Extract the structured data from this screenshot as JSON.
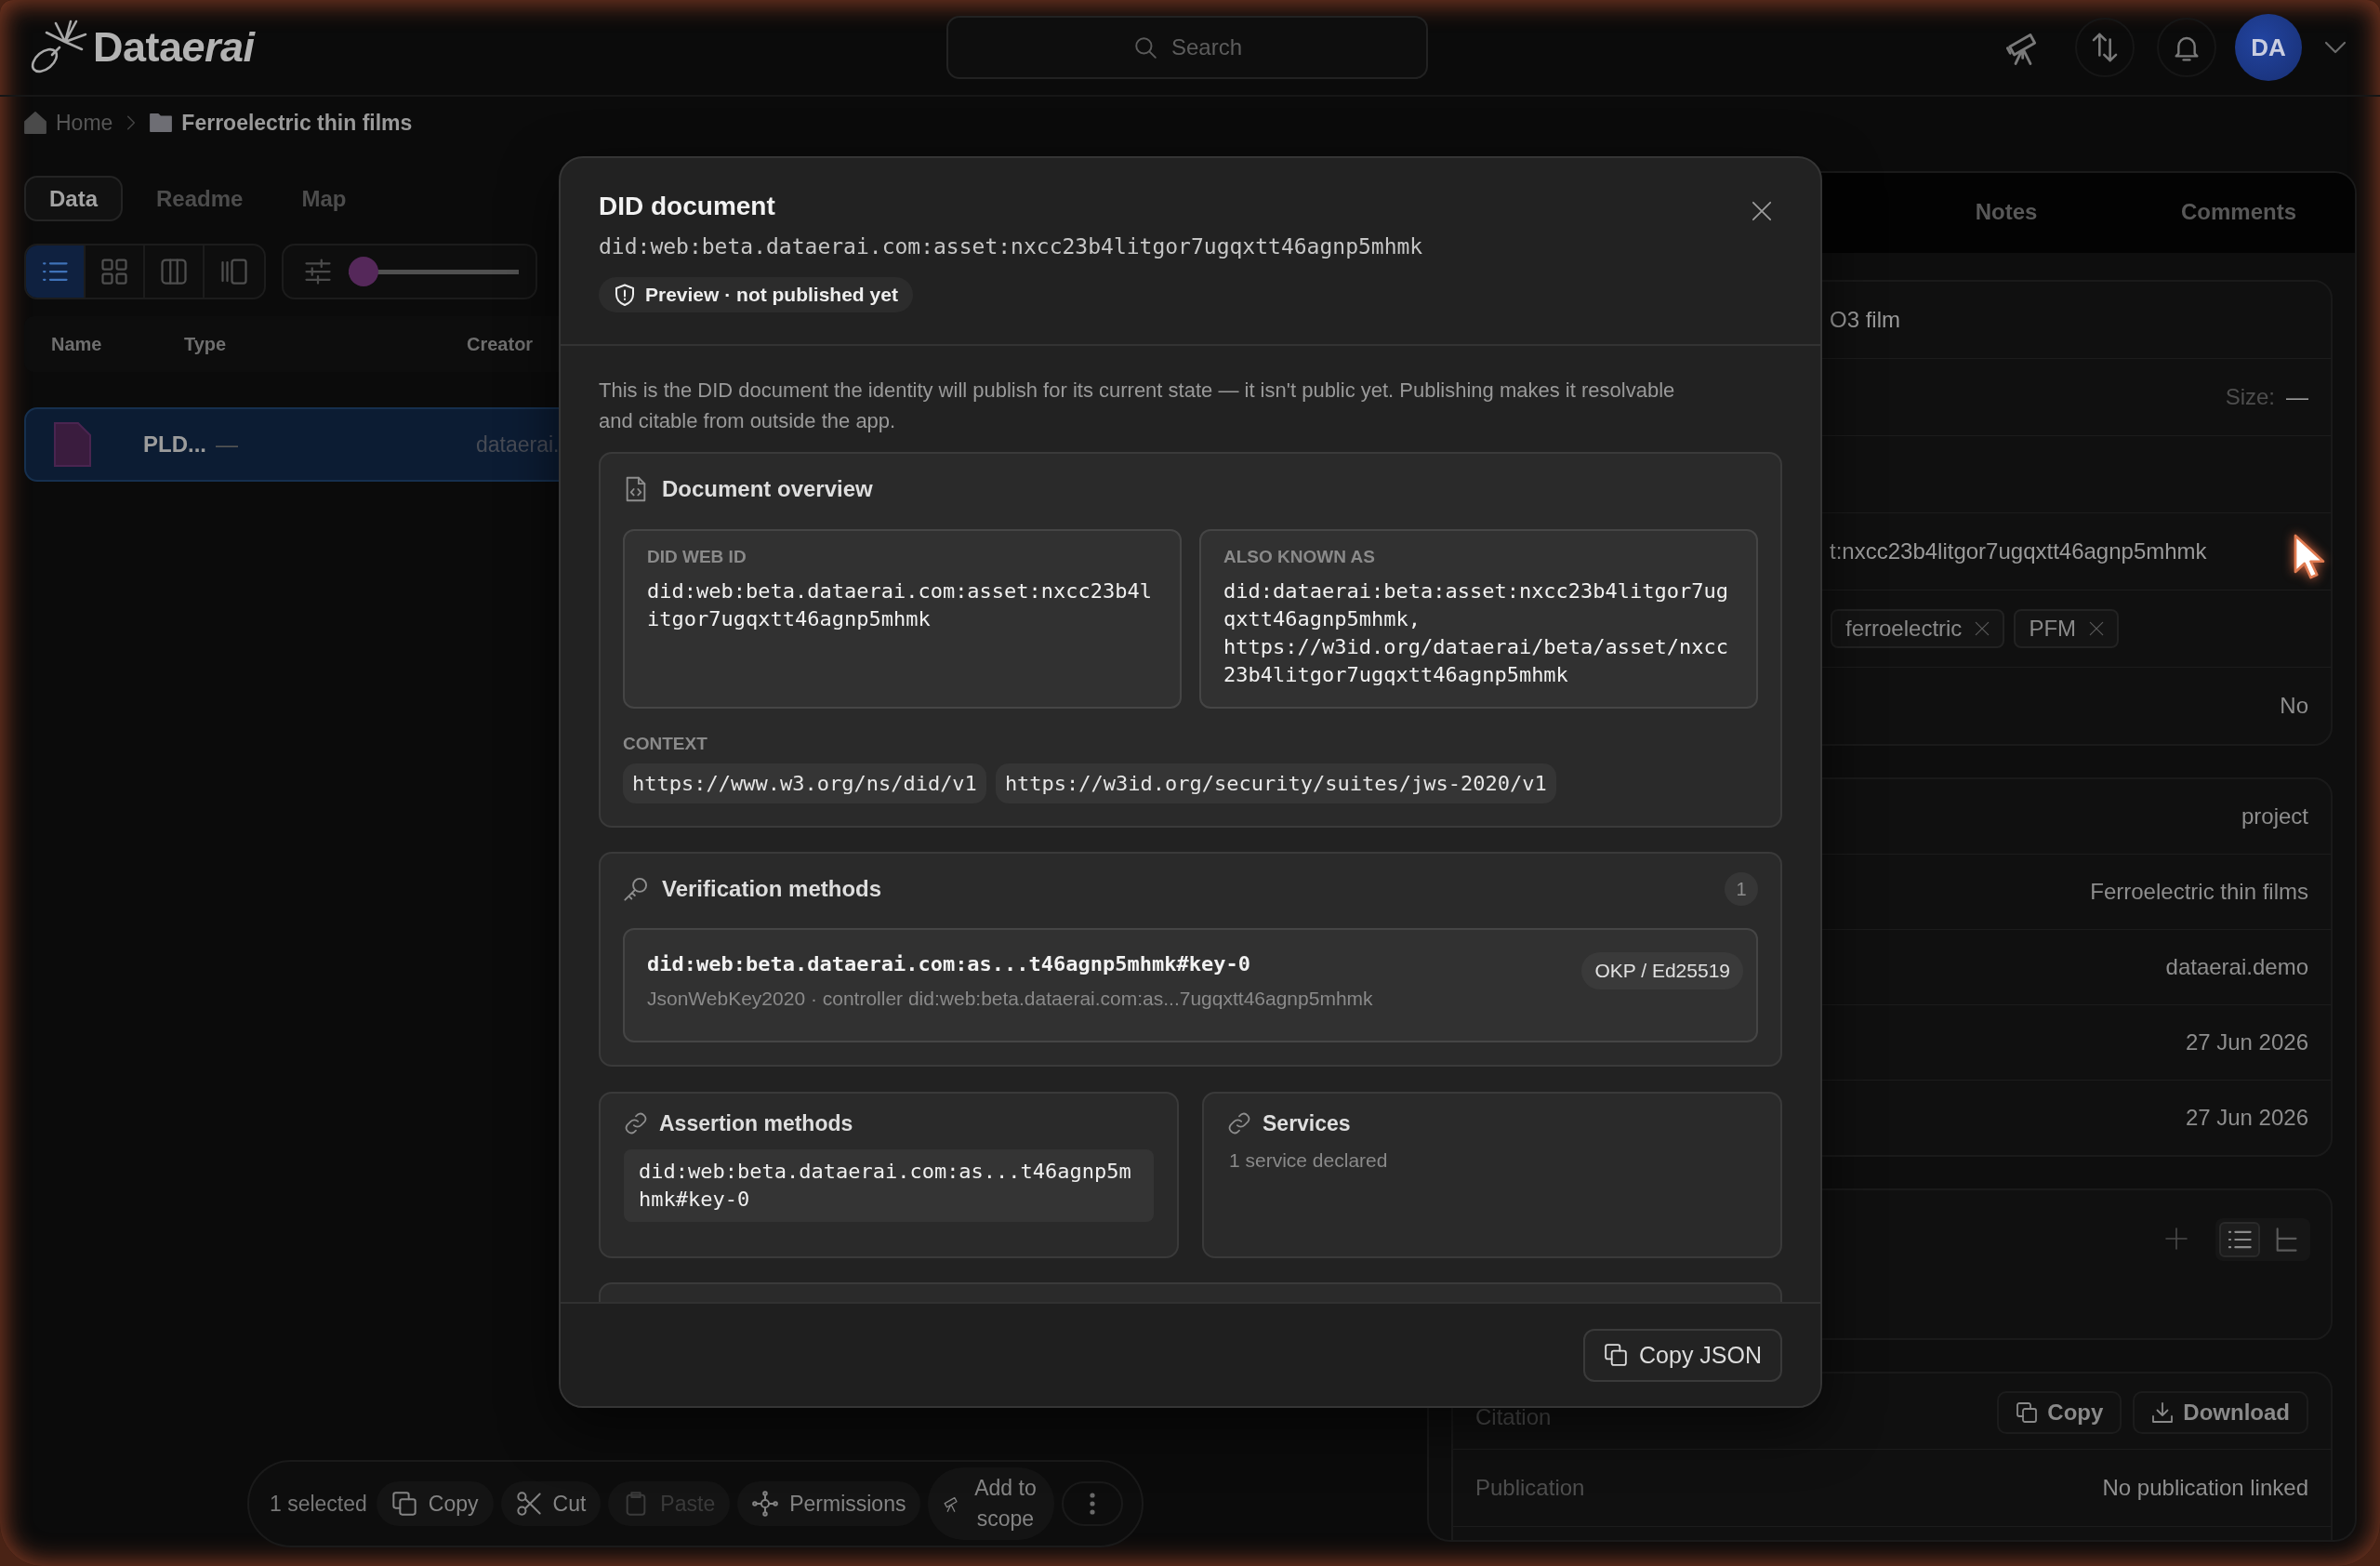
{
  "topbar": {
    "logo": [
      "Data",
      "erai"
    ],
    "search": {
      "placeholder": "Search"
    },
    "avatar": {
      "initials": "DA"
    }
  },
  "breadcrumb": [
    {
      "label": "Home",
      "kind": "home"
    },
    {
      "label": "Ferroelectric thin films",
      "kind": "folder"
    }
  ],
  "left_panel": {
    "tabs": [
      {
        "label": "Data",
        "selected": true
      },
      {
        "label": "Readme",
        "selected": false
      },
      {
        "label": "Map",
        "selected": false
      }
    ],
    "view_modes": [
      {
        "kind": "list",
        "selected": true
      },
      {
        "kind": "grid",
        "selected": false
      },
      {
        "kind": "columns",
        "selected": false
      },
      {
        "kind": "panel",
        "selected": false
      }
    ],
    "zoom_slider": {
      "level": 0
    },
    "table": {
      "columns": [
        "Name",
        "Type",
        "Creator"
      ],
      "rows": [
        {
          "name": "PLD...",
          "type": "—",
          "creator": "dataerai.",
          "selected": true
        }
      ]
    }
  },
  "details_panel": {
    "tabs": [
      {
        "label": "Notes",
        "selected": false
      },
      {
        "label": "Comments",
        "selected": false
      }
    ],
    "groups": [
      [
        {
          "kind": "text",
          "value": "O3 film"
        },
        {
          "kind": "field",
          "label": "Size:",
          "value": "—"
        },
        {
          "kind": "blank"
        },
        {
          "kind": "text",
          "value": "t:nxcc23b4litgor7ugqxtt46agnp5mhmk"
        },
        {
          "kind": "tags",
          "tags": [
            "ferroelectric",
            "PFM"
          ]
        },
        {
          "kind": "value",
          "value": "No"
        }
      ],
      [
        {
          "kind": "value",
          "value": "project"
        },
        {
          "kind": "value",
          "value": "Ferroelectric thin films"
        },
        {
          "kind": "value",
          "value": "dataerai.demo"
        },
        {
          "kind": "value",
          "value": "27 Jun 2026"
        },
        {
          "kind": "value",
          "value": "27 Jun 2026"
        }
      ]
    ],
    "children_card": {
      "view_modes": [
        {
          "kind": "list",
          "selected": true
        },
        {
          "kind": "tree",
          "selected": false
        }
      ]
    },
    "citation": {
      "label": "Citation",
      "actions": [
        {
          "label": "Copy",
          "kind": "copy"
        },
        {
          "label": "Download",
          "kind": "download"
        }
      ]
    },
    "publication": {
      "label": "Publication",
      "value": "No publication linked"
    }
  },
  "modal": {
    "title": "DID document",
    "did": "did:web:beta.dataerai.com:asset:nxcc23b4litgor7ugqxtt46agnp5mhmk",
    "status_badge": "Preview · not published yet",
    "description": "This is the DID document the identity will publish for its current state — it isn't public yet. Publishing makes it resolvable and citable from outside the app.",
    "overview": {
      "title": "Document overview",
      "fields": [
        {
          "label": "DID WEB ID",
          "values": [
            "did:web:beta.dataerai.com:asset:nxcc23b4litgor7ugqxtt46agnp5mhmk"
          ]
        },
        {
          "label": "ALSO KNOWN AS",
          "values": [
            "did:dataerai:beta:asset:nxcc23b4litgor7ugqxtt46agnp5mhmk,",
            "https://w3id.org/dataerai/beta/asset/nxcc23b4litgor7ugqxtt46agnp5mhmk"
          ]
        }
      ],
      "context_label": "CONTEXT",
      "context": [
        "https://www.w3.org/ns/did/v1",
        "https://w3id.org/security/suites/jws-2020/v1"
      ]
    },
    "verification": {
      "title": "Verification methods",
      "count": "1",
      "methods": [
        {
          "id": "did:web:beta.dataerai.com:as...t46agnp5mhmk#key-0",
          "key_type": "OKP / Ed25519",
          "detail": "JsonWebKey2020 · controller did:web:beta.dataerai.com:as...7ugqxtt46agnp5mhmk"
        }
      ]
    },
    "assertion": {
      "title": "Assertion methods",
      "values": [
        "did:web:beta.dataerai.com:as...t46agnp5mhmk#key-0"
      ]
    },
    "services": {
      "title": "Services",
      "summary": "1 service declared"
    },
    "footer_button": "Copy JSON"
  },
  "selection_bar": {
    "count": "1 selected",
    "actions": [
      {
        "label": "Copy",
        "kind": "copy",
        "disabled": false
      },
      {
        "label": "Cut",
        "kind": "cut",
        "disabled": false
      },
      {
        "label": "Paste",
        "kind": "paste",
        "disabled": true
      },
      {
        "label": "Permissions",
        "kind": "permissions",
        "disabled": false
      },
      {
        "label": "Add to scope",
        "kind": "scope",
        "disabled": false
      }
    ]
  }
}
